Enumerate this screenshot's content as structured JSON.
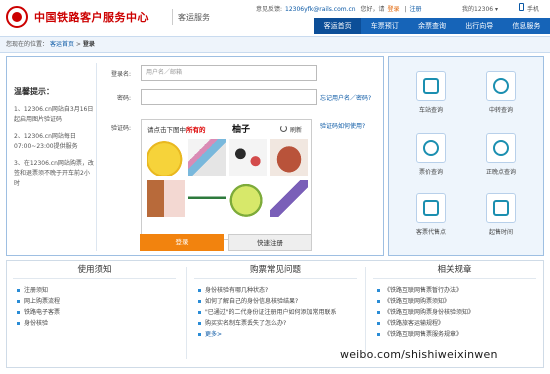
{
  "header": {
    "title": "中国铁路客户服务中心",
    "subtitle": "客运服务",
    "topbar": {
      "welcome": "意见反馈:",
      "email": "12306yfk@rails.com.cn",
      "greeting": "您好，请",
      "login": "登录",
      "register": "注册",
      "account": "我的12306 ▾",
      "mobile": "手机"
    },
    "nav": [
      "客运首页",
      "车票预订",
      "余票查询",
      "出行向导",
      "信息服务"
    ]
  },
  "breadcrumb": {
    "prefix": "您现在的位置：",
    "home": "客运首页",
    "sep": ">",
    "current": "登录"
  },
  "tips": {
    "title": "温馨提示：",
    "items": [
      "1、12306.cn网站自3月16日起启用图片验证码",
      "2、12306.cn网站每日07:00~23:00提供服务",
      "3、在12306.cn网站购票，改签和退票须不晚于开车前2小时"
    ]
  },
  "form": {
    "username_label": "登录名:",
    "username_placeholder": "用户名／邮箱",
    "password_label": "密码:",
    "forgot": "忘记用户名／密码?",
    "captcha_label": "验证码:",
    "captcha_help": "验证码如何使用?",
    "captcha_prompt_a": "请点击下图中",
    "captcha_prompt_b": "所有的",
    "captcha_word": "柚子",
    "refresh": "刷新",
    "login_button": "登录",
    "register_button": "快速注册"
  },
  "services": [
    "车站查询",
    "中转查询",
    "票价查询",
    "正晚点查询",
    "客票代售点",
    "起售时间"
  ],
  "bottom": {
    "columns": [
      {
        "title": "使用须知",
        "items": [
          "注册须知",
          "网上购票流程",
          "铁路电子客票",
          "身份核验"
        ]
      },
      {
        "title": "购票常见问题",
        "items": [
          "身份核验有哪几种状态?",
          "如何了解自己的身份信息核验结果?",
          "\"已通过\"的二代身份证注册用户如何添加常用联系",
          "购买实名制车票丢失了怎么办?"
        ],
        "more": "更多>"
      },
      {
        "title": "相关规章",
        "items": [
          "《铁路互联网售票暂行办法》",
          "《铁路互联网购票须知》",
          "《铁路互联网购票身份核验须知》",
          "《铁路旅客运输规程》",
          "《铁路互联网售票服务规章》"
        ]
      }
    ]
  },
  "watermark": "weibo.com/shishiweixinwen",
  "colors": {
    "brand": "#c00000",
    "nav": "#1664b8",
    "accent": "#f2830e"
  }
}
